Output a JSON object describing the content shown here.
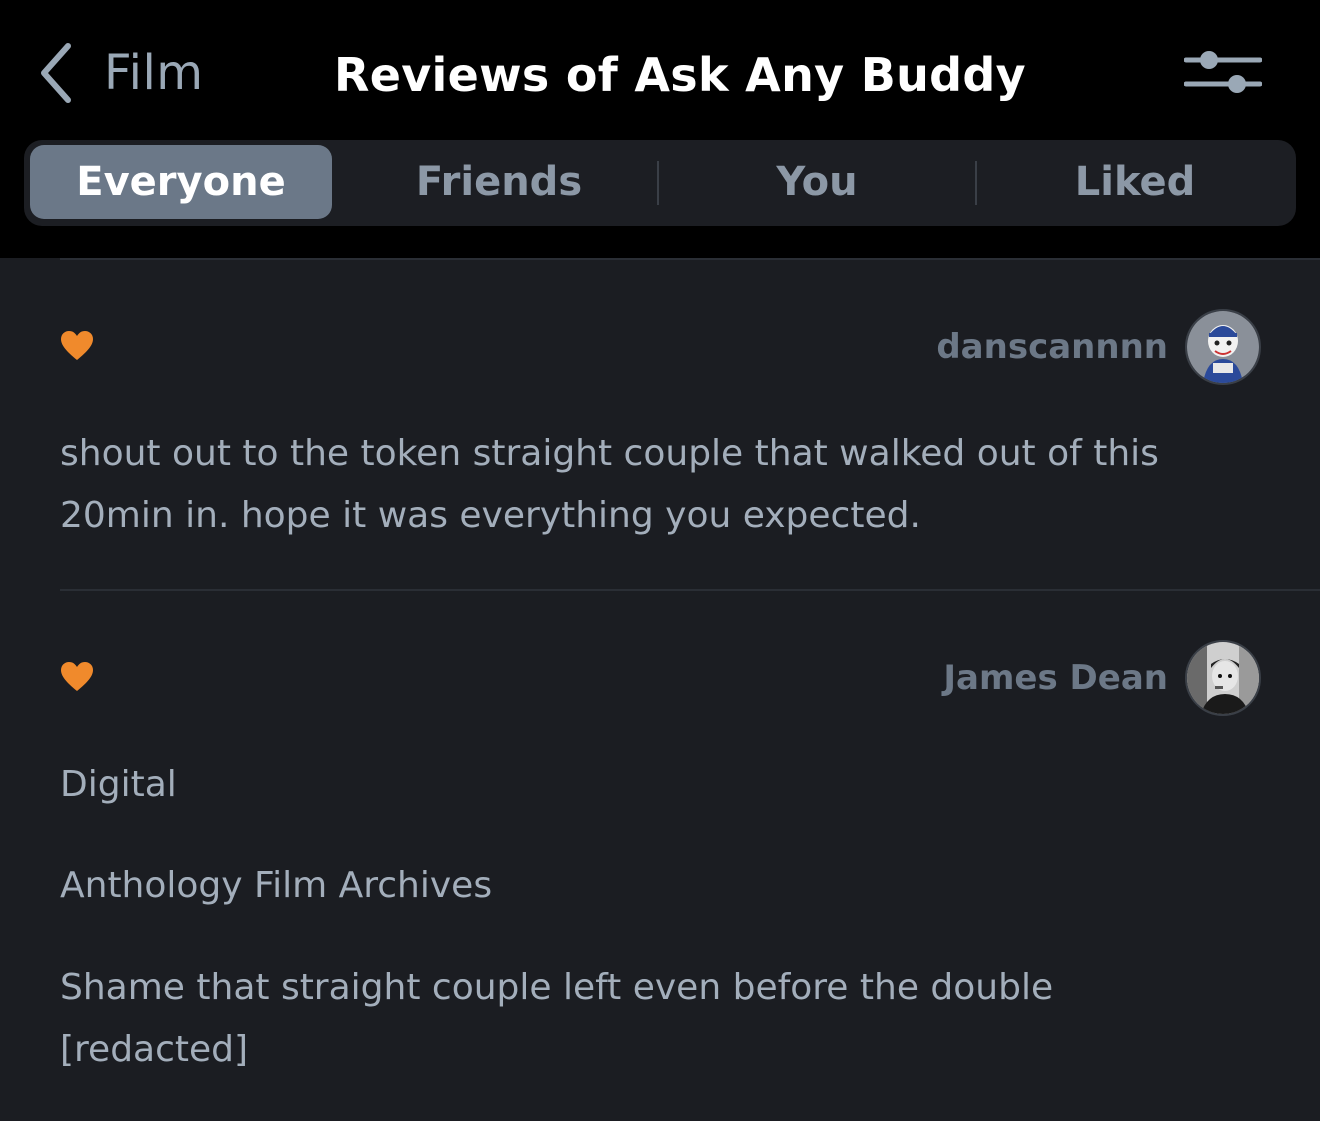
{
  "header": {
    "back_label": "Film",
    "title": "Reviews of Ask Any Buddy",
    "back_icon": "chevron-left-icon",
    "filter_icon": "sliders-icon"
  },
  "tabs": [
    {
      "label": "Everyone",
      "active": true
    },
    {
      "label": "Friends",
      "active": false
    },
    {
      "label": "You",
      "active": false
    },
    {
      "label": "Liked",
      "active": false
    }
  ],
  "reviews": [
    {
      "author": "danscannnn",
      "liked": true,
      "paragraphs": [
        "shout out to the token straight couple that walked out of this 20min in. hope it was everything you expected."
      ]
    },
    {
      "author": "James Dean",
      "liked": true,
      "paragraphs": [
        "Digital",
        "Anthology Film Archives",
        "Shame that straight couple left even before the double [redacted]"
      ]
    }
  ],
  "colors": {
    "background": "#1b1d22",
    "header_bg": "#000000",
    "active_tab": "#6b7888",
    "heart": "#f08a2c",
    "author": "#6c7887",
    "body_text": "#a3aebb"
  }
}
